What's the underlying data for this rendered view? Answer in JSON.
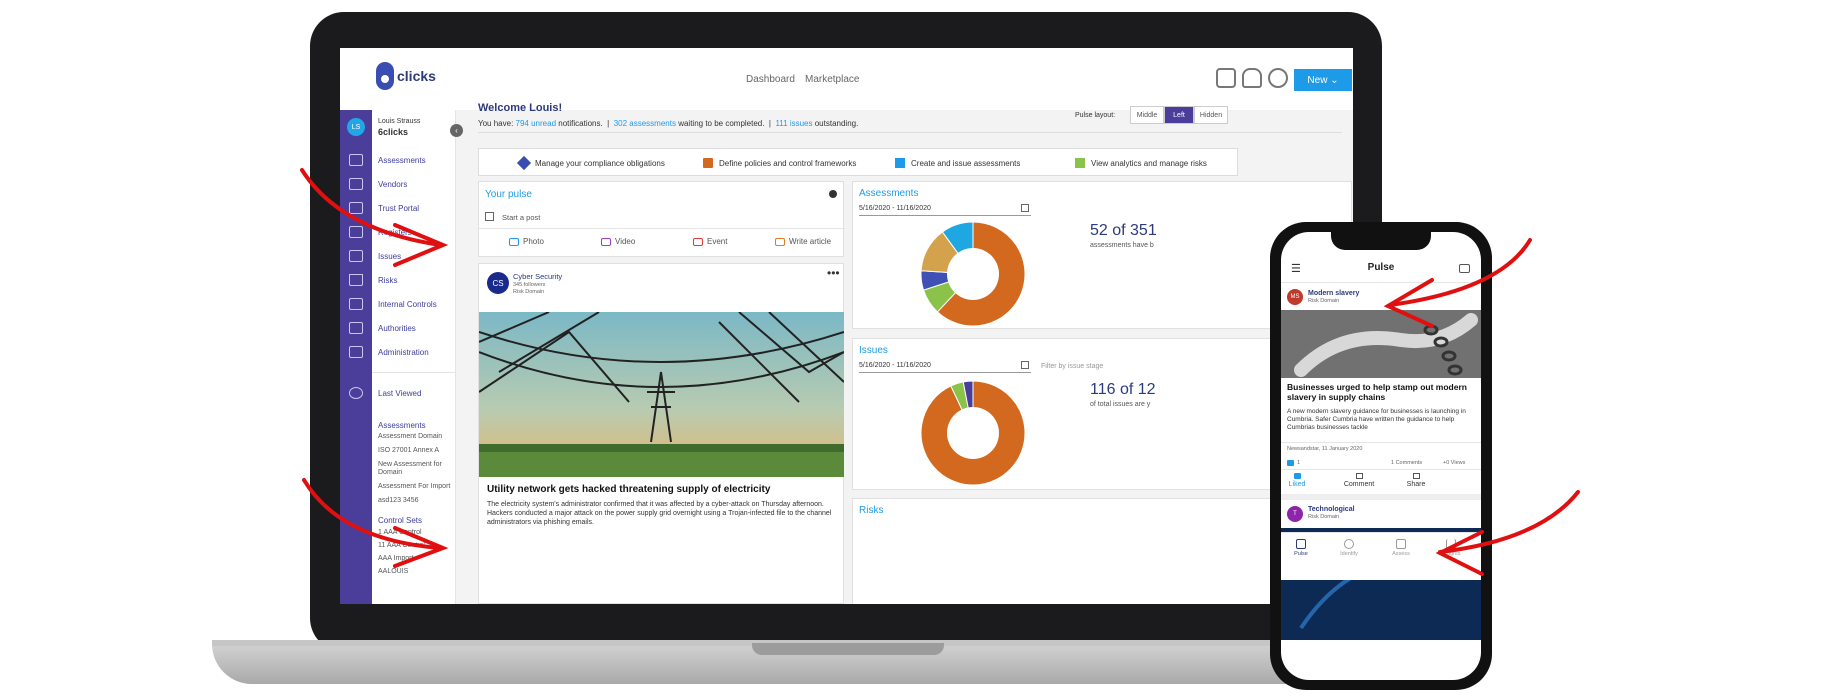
{
  "app": {
    "logo_text": "clicks",
    "nav": [
      "Dashboard",
      "Marketplace"
    ],
    "new_button": "New ⌄"
  },
  "user": {
    "initials": "LS",
    "name": "Louis Strauss",
    "org": "6clicks"
  },
  "sidebar": {
    "items": [
      "Assessments",
      "Vendors",
      "Trust Portal",
      "Registers",
      "Issues",
      "Risks",
      "Internal Controls",
      "Authorities",
      "Administration"
    ],
    "last_viewed_label": "Last Viewed",
    "assessments_header": "Assessments",
    "assessments_items": [
      "Assessment Domain",
      "ISO 27001 Annex A",
      "New Assessment for",
      "Domain",
      "Assessment For Import",
      "asd123 3456"
    ],
    "control_sets_header": "Control Sets",
    "control_sets_items": [
      "1 AAA Control",
      "11 AAA Control",
      "AAA Import",
      "AALOUIS"
    ]
  },
  "welcome": {
    "title": "Welcome Louis!",
    "prefix": "You have:",
    "unread": "794 unread",
    "unread_suffix": "notifications.",
    "assessments": "302 assessments",
    "assessments_suffix": "waiting to be completed.",
    "issues": "111 issues",
    "issues_suffix": "outstanding."
  },
  "pulse_layout": {
    "label": "Pulse layout:",
    "options": [
      "Middle",
      "Left",
      "Hidden"
    ],
    "selected": "Left"
  },
  "quick_actions": [
    "Manage your compliance obligations",
    "Define policies and control frameworks",
    "Create and issue assessments",
    "View analytics and manage risks"
  ],
  "pulse": {
    "title": "Your pulse",
    "start_post": "Start a post",
    "actions": [
      "Photo",
      "Video",
      "Event",
      "Write article"
    ]
  },
  "feed_post": {
    "avatar": "CS",
    "author": "Cyber Security",
    "followers": "345 followers",
    "domain": "Risk Domain",
    "headline": "Utility network gets hacked threatening supply of electricity",
    "body": "The electricity system's administrator confirmed that it was affected by a cyber-attack on Thursday afternoon. Hackers conducted a major attack on the power supply grid overnight using a Trojan-infected file to the channel administrators via phishing emails."
  },
  "assessments_card": {
    "title": "Assessments",
    "date_range": "5/16/2020 - 11/16/2020",
    "big_number": "52 of 351",
    "caption": "assessments have b"
  },
  "issues_card": {
    "title": "Issues",
    "date_range": "5/16/2020 - 11/16/2020",
    "filter": "Filter by issue stage",
    "big_number": "116 of 12",
    "caption": "of total issues are y"
  },
  "risks_card": {
    "title": "Risks"
  },
  "chart_data": [
    {
      "type": "pie",
      "values": [
        62,
        8,
        6,
        14,
        10
      ],
      "colors": [
        "#d2691e",
        "#8bc34a",
        "#3f51b5",
        "#d4a24c",
        "#1ea7e0"
      ]
    },
    {
      "type": "pie",
      "values": [
        93,
        4,
        3
      ],
      "colors": [
        "#d2691e",
        "#8bc34a",
        "#4a3e9a"
      ]
    }
  ],
  "phone": {
    "title": "Pulse",
    "post1": {
      "avatar": "MS",
      "name": "Modern slavery",
      "domain": "Risk Domain",
      "headline": "Businesses urged to help stamp out modern slavery in supply chains",
      "body": "A new modern slavery guidance for businesses is launching in Cumbria. Safer Cumbria have written the guidance to help Cumbrias businesses tackle",
      "source": "Newsandstar, 11 January 2020",
      "likes": "1",
      "comments": "1 Comments",
      "views": "+0 Views"
    },
    "actions": [
      "Liked",
      "Comment",
      "Share"
    ],
    "post2": {
      "avatar": "T",
      "name": "Technological",
      "domain": "Risk Domain"
    },
    "tabs": [
      "Pulse",
      "Identify",
      "Assess",
      "Insights"
    ]
  },
  "colors": {
    "brand": "#4a3e9a",
    "accent": "#1e9be8",
    "arrow": "#e01010"
  }
}
